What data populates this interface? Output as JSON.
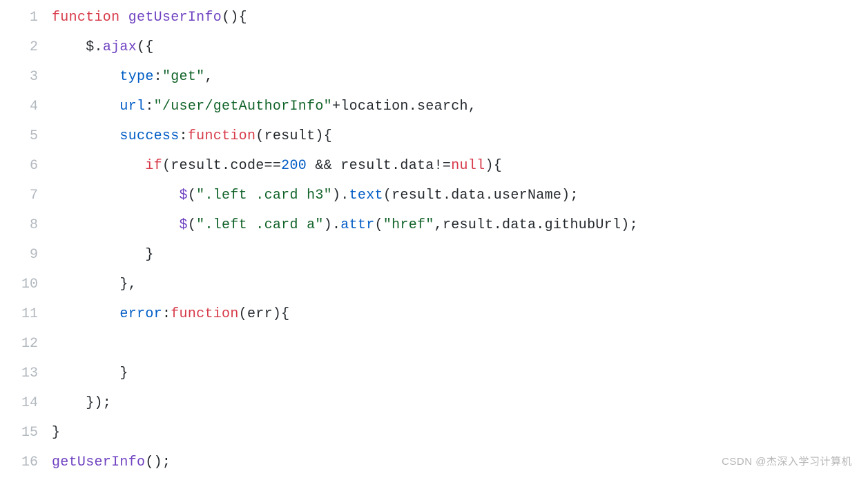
{
  "watermark": "CSDN @杰深入学习计算机",
  "lines": [
    {
      "n": "1",
      "tokens": [
        [
          "kw",
          "function"
        ],
        [
          "pn",
          " "
        ],
        [
          "fn",
          "getUserInfo"
        ],
        [
          "pn",
          "(){"
        ]
      ]
    },
    {
      "n": "2",
      "tokens": [
        [
          "pn",
          "    $."
        ],
        [
          "fn",
          "ajax"
        ],
        [
          "pn",
          "({"
        ]
      ]
    },
    {
      "n": "3",
      "tokens": [
        [
          "pn",
          "        "
        ],
        [
          "attr",
          "type"
        ],
        [
          "pn",
          ":"
        ],
        [
          "str",
          "\"get\""
        ],
        [
          "pn",
          ","
        ]
      ]
    },
    {
      "n": "4",
      "tokens": [
        [
          "pn",
          "        "
        ],
        [
          "attr",
          "url"
        ],
        [
          "pn",
          ":"
        ],
        [
          "str",
          "\"/user/getAuthorInfo\""
        ],
        [
          "pn",
          "+location.search,"
        ]
      ]
    },
    {
      "n": "5",
      "tokens": [
        [
          "pn",
          "        "
        ],
        [
          "attr",
          "success"
        ],
        [
          "pn",
          ":"
        ],
        [
          "kw",
          "function"
        ],
        [
          "pn",
          "(result){"
        ]
      ]
    },
    {
      "n": "6",
      "tokens": [
        [
          "pn",
          "           "
        ],
        [
          "kw",
          "if"
        ],
        [
          "pn",
          "(result.code=="
        ],
        [
          "num",
          "200"
        ],
        [
          "pn",
          " && result.data!="
        ],
        [
          "kw",
          "null"
        ],
        [
          "pn",
          "){"
        ]
      ]
    },
    {
      "n": "7",
      "tokens": [
        [
          "pn",
          "               "
        ],
        [
          "fn",
          "$"
        ],
        [
          "pn",
          "("
        ],
        [
          "str",
          "\".left .card h3\""
        ],
        [
          "pn",
          ")."
        ],
        [
          "attr",
          "text"
        ],
        [
          "pn",
          "(result.data.userName);"
        ]
      ]
    },
    {
      "n": "8",
      "tokens": [
        [
          "pn",
          "               "
        ],
        [
          "fn",
          "$"
        ],
        [
          "pn",
          "("
        ],
        [
          "str",
          "\".left .card a\""
        ],
        [
          "pn",
          ")."
        ],
        [
          "attr",
          "attr"
        ],
        [
          "pn",
          "("
        ],
        [
          "str",
          "\"href\""
        ],
        [
          "pn",
          ",result.data.githubUrl);"
        ]
      ]
    },
    {
      "n": "9",
      "tokens": [
        [
          "pn",
          "           }"
        ]
      ]
    },
    {
      "n": "10",
      "tokens": [
        [
          "pn",
          "        },"
        ]
      ]
    },
    {
      "n": "11",
      "tokens": [
        [
          "pn",
          "        "
        ],
        [
          "attr",
          "error"
        ],
        [
          "pn",
          ":"
        ],
        [
          "kw",
          "function"
        ],
        [
          "pn",
          "(err){"
        ]
      ]
    },
    {
      "n": "12",
      "tokens": [
        [
          "pn",
          ""
        ]
      ]
    },
    {
      "n": "13",
      "tokens": [
        [
          "pn",
          "        }"
        ]
      ]
    },
    {
      "n": "14",
      "tokens": [
        [
          "pn",
          "    });"
        ]
      ]
    },
    {
      "n": "15",
      "tokens": [
        [
          "pn",
          "}"
        ]
      ]
    },
    {
      "n": "16",
      "tokens": [
        [
          "fn",
          "getUserInfo"
        ],
        [
          "pn",
          "();"
        ]
      ]
    }
  ]
}
